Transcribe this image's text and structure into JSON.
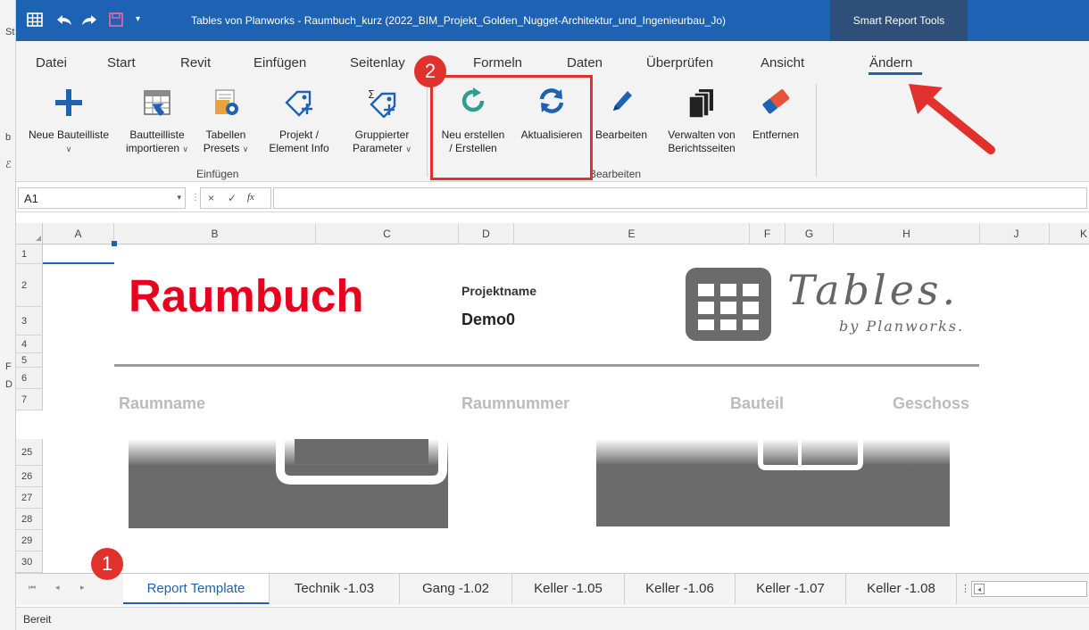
{
  "titlebar": {
    "title": "Tables von Planworks - Raumbuch_kurz  (2022_BIM_Projekt_Golden_Nugget-Architektur_und_Ingenieurbau_Jo)",
    "context_tab": "Smart Report Tools"
  },
  "menu": {
    "tabs": [
      "Datei",
      "Start",
      "Revit",
      "Einfügen",
      "Seitenlay",
      "Formeln",
      "Daten",
      "Überprüfen",
      "Ansicht",
      "Ändern"
    ],
    "active": "Ändern"
  },
  "ribbon": {
    "einfuegen_group": "Einfügen",
    "bearbeiten_group": "Bearbeiten",
    "buttons": {
      "neue_bauteilliste": "Neue Bauteilliste",
      "bauteilliste_importieren_1": "Bautteilliste",
      "bauteilliste_importieren_2": "importieren",
      "tabellen_presets_1": "Tabellen",
      "tabellen_presets_2": "Presets",
      "projekt_info_1": "Projekt /",
      "projekt_info_2": "Element Info",
      "gruppierter_1": "Gruppierter",
      "gruppierter_2": "Parameter",
      "neu_erstellen_1": "Neu erstellen",
      "neu_erstellen_2": "/ Erstellen",
      "aktualisieren": "Aktualisieren",
      "bearbeiten": "Bearbeiten",
      "verwalten_1": "Verwalten von",
      "verwalten_2": "Berichtsseiten",
      "entfernen": "Entfernen"
    }
  },
  "formula_bar": {
    "name_box": "A1",
    "cancel": "×",
    "confirm": "✓",
    "fx": "fx"
  },
  "columns": [
    "A",
    "B",
    "C",
    "D",
    "E",
    "F",
    "G",
    "H",
    "J",
    "K"
  ],
  "rows": [
    "1",
    "2",
    "3",
    "4",
    "5",
    "6",
    "7",
    "25",
    "26",
    "27",
    "28",
    "29",
    "30"
  ],
  "sheet": {
    "title": "Raumbuch",
    "project_label": "Projektname",
    "project_value": "Demo0",
    "logo_text": "Tables.",
    "logo_sub": "by Planworks.",
    "headers": [
      "Raumname",
      "Raumnummer",
      "Bauteil",
      "Geschoss"
    ]
  },
  "sheet_tabs": [
    "Report Template",
    "Technik -1.03",
    "Gang -1.02",
    "Keller -1.05",
    "Keller -1.06",
    "Keller -1.07",
    "Keller -1.08"
  ],
  "active_sheet": "Report Template",
  "status": "Bereit",
  "badges": [
    "1",
    "2"
  ],
  "colors": {
    "title_bar": "#1e62b4",
    "context_tab": "#2d4f78",
    "accent_red": "#e0312c",
    "raumbuch_red": "#e8001c"
  },
  "left_strip_glyphs": [
    "St",
    "b",
    "ℰ",
    "F",
    "D"
  ]
}
